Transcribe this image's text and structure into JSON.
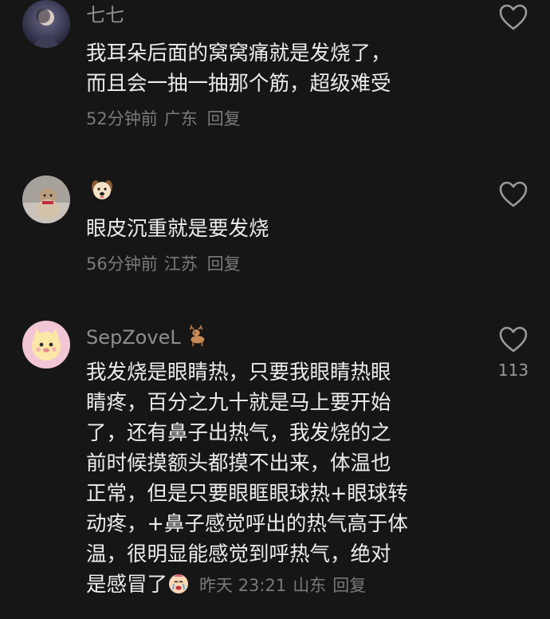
{
  "comments": [
    {
      "username": "七七",
      "text_lines": [
        "我耳朵后面的窝窝痛就是发烧了，",
        "而且会一抽一抽那个筋，超级难受"
      ],
      "time": "52分钟前",
      "location": "广东",
      "reply_label": "回复"
    },
    {
      "username_emoji": "dog-face-emoji",
      "text_lines": [
        "眼皮沉重就是要发烧"
      ],
      "time": "56分钟前",
      "location": "江苏",
      "reply_label": "回复"
    },
    {
      "username": "SepZoveL",
      "username_emoji": "deer-emoji",
      "text_lines": [
        "我发烧是眼睛热，只要我眼睛热眼",
        "睛疼，百分之九十就是马上要开始",
        "了，还有鼻子出热气，我发烧的之",
        "前时候摸额头都摸不出来，体温也",
        "正常，但是只要眼眶眼球热+眼球转",
        "动疼，+鼻子感觉呼出的热气高于体",
        "温，很明显能感觉到呼热气，绝对",
        "是感冒了"
      ],
      "trailing_emoji": "crying-face-emoji",
      "time": "昨天 23:21",
      "location": "山东",
      "reply_label": "回复",
      "like_count": "113"
    }
  ],
  "colors": {
    "background": "#161616",
    "text": "#ececec",
    "meta": "#7a7a7a",
    "username": "#8e8e8e"
  }
}
